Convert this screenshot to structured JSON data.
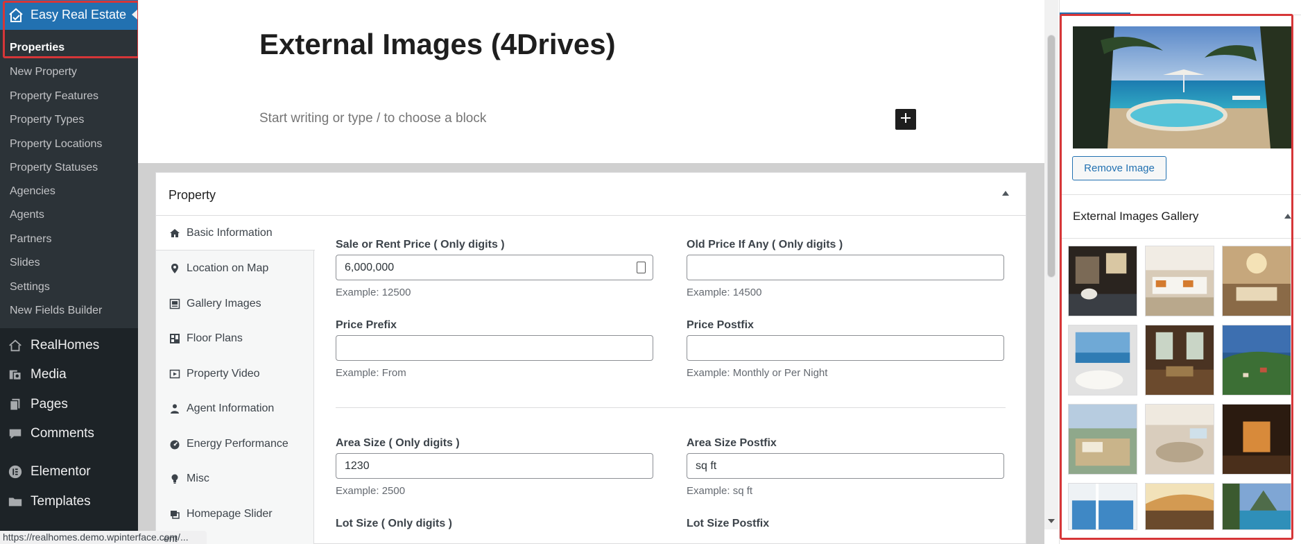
{
  "sidebar": {
    "plugin_title": "Easy Real Estate",
    "current_item": "Properties",
    "sub_items": [
      "New Property",
      "Property Features",
      "Property Types",
      "Property Locations",
      "Property Statuses",
      "Agencies",
      "Agents",
      "Partners",
      "Slides",
      "Settings",
      "New Fields Builder"
    ],
    "main_items": [
      "RealHomes",
      "Media",
      "Pages",
      "Comments",
      "Elementor",
      "Templates"
    ],
    "status_url": "https://realhomes.demo.wpinterface.com/...",
    "status_overlay": "ent"
  },
  "editor": {
    "post_title": "External Images (4Drives)",
    "block_placeholder": "Start writing or type / to choose a block"
  },
  "panel": {
    "title": "Property",
    "tabs": [
      "Basic Information",
      "Location on Map",
      "Gallery Images",
      "Floor Plans",
      "Property Video",
      "Agent Information",
      "Energy Performance",
      "Misc",
      "Homepage Slider"
    ],
    "fields": {
      "sale_price_label": "Sale or Rent Price ( Only digits )",
      "sale_price_value": "6,000,000",
      "sale_price_help": "Example: 12500",
      "old_price_label": "Old Price If Any ( Only digits )",
      "old_price_value": "",
      "old_price_help": "Example: 14500",
      "price_prefix_label": "Price Prefix",
      "price_prefix_value": "",
      "price_prefix_help": "Example: From",
      "price_postfix_label": "Price Postfix",
      "price_postfix_value": "",
      "price_postfix_help": "Example: Monthly or Per Night",
      "area_size_label": "Area Size ( Only digits )",
      "area_size_value": "1230",
      "area_size_help": "Example: 2500",
      "area_postfix_label": "Area Size Postfix",
      "area_postfix_value": "sq ft",
      "area_postfix_help": "Example: sq ft",
      "lot_size_label": "Lot Size ( Only digits )",
      "lot_postfix_label": "Lot Size Postfix"
    }
  },
  "rightbar": {
    "remove_image_label": "Remove Image",
    "gallery_title": "External Images Gallery"
  },
  "colors": {
    "wp_blue": "#2271b1",
    "sidebar_dark": "#1d2327",
    "highlight_red": "#d63638"
  }
}
